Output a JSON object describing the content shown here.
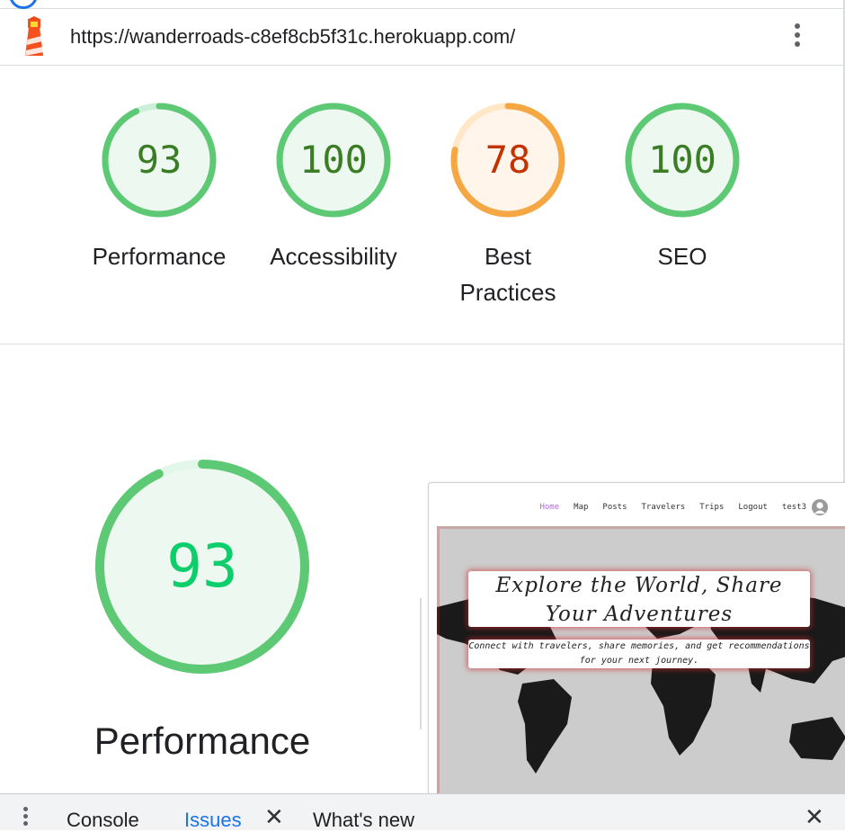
{
  "url_bar": {
    "url": "https://wanderroads-c8ef8cb5f31c.herokuapp.com/",
    "logo_icon": "lighthouse-icon",
    "menu_icon": "kebab-menu-icon"
  },
  "gauges": [
    {
      "score": "93",
      "label": "Performance",
      "status": "pass",
      "color": "#0cce6b",
      "text_color": "#3a7d24"
    },
    {
      "score": "100",
      "label": "Accessibility",
      "status": "pass",
      "color": "#0cce6b",
      "text_color": "#3a7d24"
    },
    {
      "score": "78",
      "label": "Best Practices",
      "label_lines": [
        "Best",
        "Practices"
      ],
      "status": "average",
      "color": "#ffa400",
      "text_color": "#c33300"
    },
    {
      "score": "100",
      "label": "SEO",
      "status": "pass",
      "color": "#0cce6b",
      "text_color": "#3a7d24"
    }
  ],
  "detail": {
    "score": "93",
    "label": "Performance",
    "color": "#0cce6b"
  },
  "thumbnail": {
    "nav": [
      "Home",
      "Map",
      "Posts",
      "Travelers",
      "Trips",
      "Logout",
      "test3"
    ],
    "active_nav": "Home",
    "hero_title": "Explore the World, Share Your Adventures",
    "hero_title_lines": [
      "Explore the World, Share",
      "Your Adventures"
    ],
    "hero_subtitle_lines": [
      "Connect with travelers, share memories, and get recommendations",
      "for your next journey."
    ]
  },
  "drawer": {
    "tabs": [
      "Console",
      "Issues",
      "What's new"
    ],
    "active_tab": "Issues",
    "close_icon": "close-icon",
    "menu_icon": "vertical-dots-icon"
  }
}
